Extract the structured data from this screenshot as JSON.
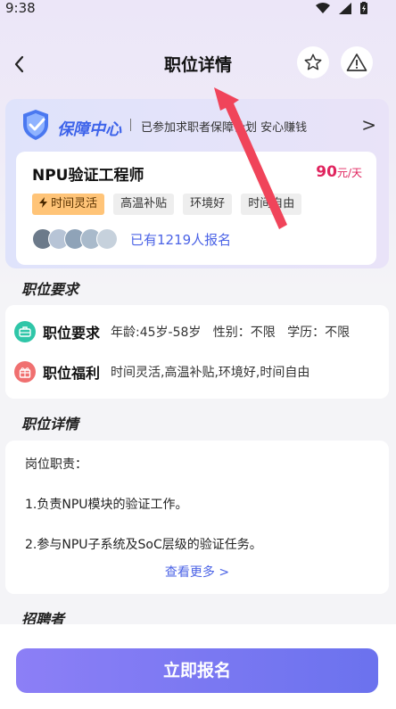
{
  "status_bar": {
    "time": "9:38"
  },
  "nav": {
    "title": "职位详情",
    "back": "<"
  },
  "guarantee": {
    "title": "保障中心",
    "text": "已参加求职者保障计划 安心赚钱",
    "arrow": ">"
  },
  "job": {
    "title": "NPU验证工程师",
    "salary_amount": "90",
    "salary_unit": "元/天",
    "tags": [
      "时间灵活",
      "高温补贴",
      "环境好",
      "时间自由"
    ],
    "applicants_text": "已有1219人报名"
  },
  "requirements": {
    "heading": "职位要求",
    "req_label": "职位要求",
    "req_value": "年龄:45岁-58岁   性别：不限   学历：不限",
    "benefit_label": "职位福利",
    "benefit_value": "时间灵活,高温补贴,环境好,时间自由"
  },
  "details": {
    "heading": "职位详情",
    "lines": [
      "岗位职责：",
      "1.负责NPU模块的验证工作。",
      "2.参与NPU子系统及SoC层级的验证任务。"
    ],
    "more": "查看更多 >"
  },
  "recruiter": {
    "heading": "招聘者"
  },
  "footer": {
    "apply": "立即报名"
  },
  "colors": {
    "accent": "#4b63e6",
    "salary": "#e0245e",
    "tag_highlight": "#ffc478",
    "annotation": "#f0445a"
  },
  "icons": [
    "wifi-icon",
    "signal-icon",
    "battery-icon",
    "back-arrow-icon",
    "star-icon",
    "warning-icon",
    "shield-check-icon",
    "bolt-icon",
    "briefcase-icon",
    "gift-icon",
    "chevron-right-icon"
  ]
}
